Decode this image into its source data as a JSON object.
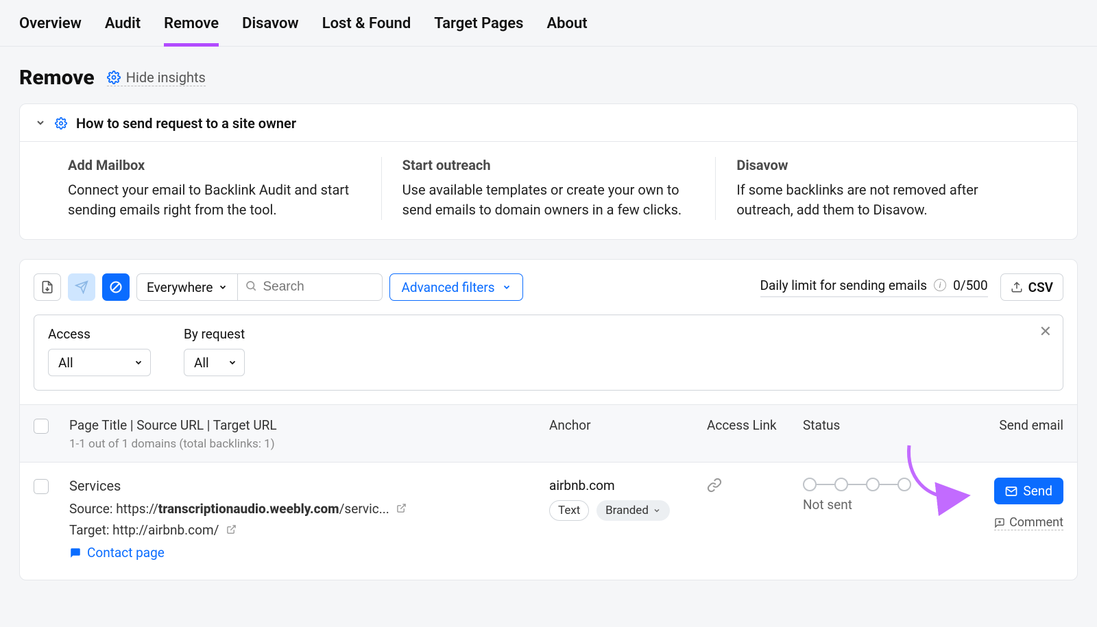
{
  "tabs": [
    "Overview",
    "Audit",
    "Remove",
    "Disavow",
    "Lost & Found",
    "Target Pages",
    "About"
  ],
  "active_tab": "Remove",
  "page_title": "Remove",
  "hide_insights": "Hide insights",
  "accordion_title": "How to send request to a site owner",
  "insights": [
    {
      "title": "Add Mailbox",
      "desc": "Connect your email to Backlink Audit and start sending emails right from the tool."
    },
    {
      "title": "Start outreach",
      "desc": "Use available templates or create your own to send emails to domain owners in a few clicks."
    },
    {
      "title": "Disavow",
      "desc": "If some backlinks are not removed after outreach, add them to Disavow."
    }
  ],
  "toolbar": {
    "scope": "Everywhere",
    "search_placeholder": "Search",
    "adv_filters": "Advanced filters",
    "limit_label": "Daily limit for sending emails",
    "limit_current": "0",
    "limit_sep": "/",
    "limit_max": "500",
    "csv": "CSV"
  },
  "filters": {
    "access_label": "Access",
    "access_value": "All",
    "byreq_label": "By request",
    "byreq_value": "All"
  },
  "columns": {
    "title": "Page Title | Source URL | Target URL",
    "sub": "1-1 out of 1 domains (total backlinks: 1)",
    "anchor": "Anchor",
    "access": "Access Link",
    "status": "Status",
    "send": "Send email"
  },
  "row": {
    "title": "Services",
    "source_label": "Source: ",
    "source_pre": "https://",
    "source_domain": "transcriptionaudio.weebly.com",
    "source_rest": "/servic...",
    "target_label": "Target: ",
    "target_url": "http://airbnb.com/",
    "contact": "Contact page",
    "anchor": "airbnb.com",
    "tag_text": "Text",
    "tag_branded": "Branded",
    "status": "Not sent",
    "send": "Send",
    "comment": "Comment"
  }
}
